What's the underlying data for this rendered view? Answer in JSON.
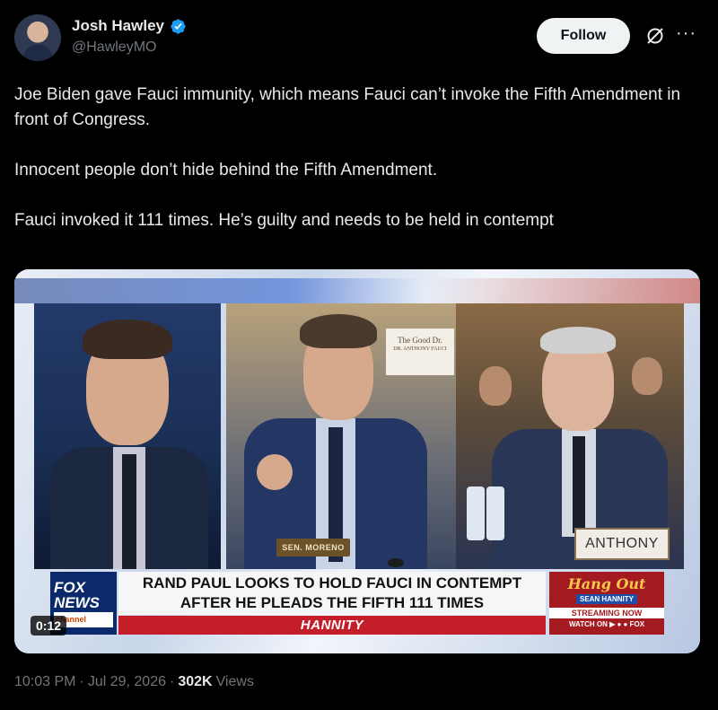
{
  "author": {
    "name": "Josh Hawley",
    "handle": "@HawleyMO",
    "verified": true,
    "avatar_icon": "avatar-photo"
  },
  "actions": {
    "follow_label": "Follow",
    "grok_icon": "grok-slash-icon",
    "more_label": "···"
  },
  "tweet": {
    "paragraphs": [
      "Joe Biden gave Fauci immunity, which means Fauci can’t invoke the Fifth Amendment in front of Congress.",
      "Innocent people don’t hide behind the Fifth Amendment.",
      "Fauci invoked it 111 times. He’s guilty and needs to be held in contempt"
    ]
  },
  "media": {
    "poster_text": "The Good Dr.",
    "poster_subtext": "DR. ANTHONY FAUCI",
    "nameplate_left": "SEN. MORENO",
    "nameplate_right": "ANTHONY",
    "channel_logo_line1": "FOX",
    "channel_logo_line2": "NEWS",
    "channel_logo_line3": "channel",
    "headline": "RAND PAUL LOOKS TO HOLD FAUCI IN CONTEMPT AFTER HE PLEADS THE FIFTH 111 TIMES",
    "show_name": "HANNITY",
    "promo": {
      "title": "Hang Out",
      "host": "SEAN HANNITY",
      "streaming": "STREAMING NOW",
      "watch": "WATCH ON ▶ ● ● FOX"
    },
    "duration": "0:12"
  },
  "meta": {
    "time": "10:03 PM",
    "separator": "·",
    "date": "Jul 29, 2026",
    "views_count": "302K",
    "views_label": "Views"
  },
  "colors": {
    "background": "#000000",
    "text_primary": "#e7e9ea",
    "text_secondary": "#71767b",
    "verified_blue": "#1d9bf0",
    "follow_bg": "#eff3f4"
  }
}
